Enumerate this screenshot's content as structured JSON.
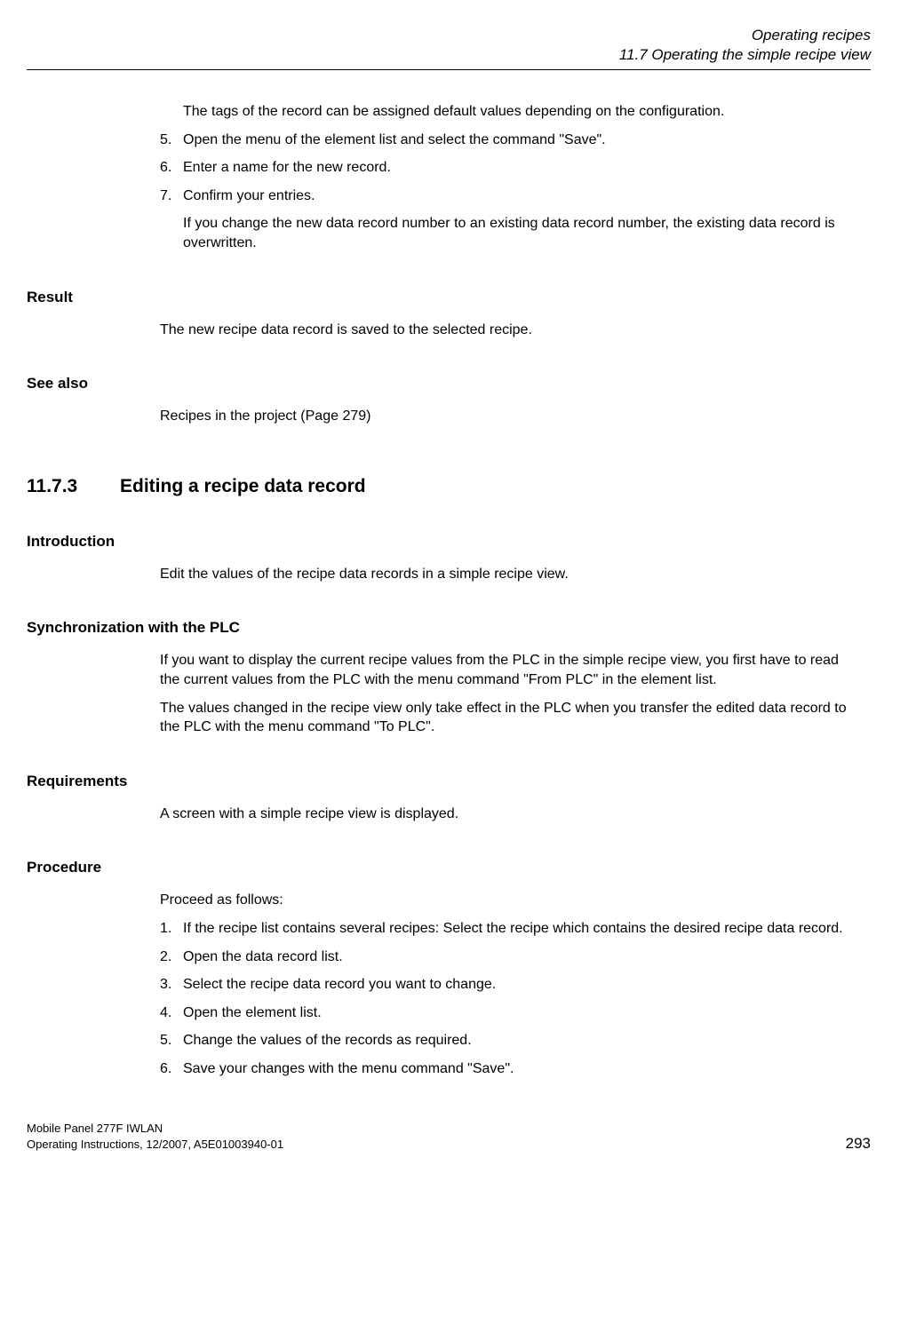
{
  "header": {
    "title": "Operating recipes",
    "subtitle": "11.7 Operating the simple recipe view"
  },
  "intro": {
    "para1": "The tags of the record can be assigned default values depending on the configuration.",
    "item5_num": "5.",
    "item5_text": "Open the menu of the element list and select the command \"Save\".",
    "item6_num": "6.",
    "item6_text": "Enter a name for the new record.",
    "item7_num": "7.",
    "item7_text": "Confirm your entries.",
    "item7_sub": "If you change the new data record number to an existing data record number, the existing data record is overwritten."
  },
  "result": {
    "label": "Result",
    "text": "The new recipe data record is saved to the selected recipe."
  },
  "seealso": {
    "label": "See also",
    "text": "Recipes in the project (Page 279)"
  },
  "section": {
    "number": "11.7.3",
    "title": "Editing a recipe data record"
  },
  "introduction": {
    "label": "Introduction",
    "text": "Edit the values of the recipe data records in a simple recipe view."
  },
  "sync": {
    "label": "Synchronization with the PLC",
    "para1": "If you want to display the current recipe values from the PLC in the simple recipe view, you first have to read the current values from the PLC with the menu command \"From PLC\" in the element list.",
    "para2": "The values changed in the recipe view only take effect in the PLC when you transfer the edited data record to the PLC with the menu command \"To PLC\"."
  },
  "requirements": {
    "label": "Requirements",
    "text": "A screen with a simple recipe view is displayed."
  },
  "procedure": {
    "label": "Procedure",
    "intro": "Proceed as follows:",
    "n1": "1.",
    "t1": "If the recipe list contains several recipes: Select the recipe which contains the desired recipe data record.",
    "n2": "2.",
    "t2": "Open the data record list.",
    "n3": "3.",
    "t3": "Select the recipe data record you want to change.",
    "n4": "4.",
    "t4": "Open the element list.",
    "n5": "5.",
    "t5": "Change the values of the records as required.",
    "n6": "6.",
    "t6": "Save your changes with the menu command \"Save\"."
  },
  "footer": {
    "line1": "Mobile Panel 277F IWLAN",
    "line2": "Operating Instructions, 12/2007, A5E01003940-01",
    "page": "293"
  }
}
